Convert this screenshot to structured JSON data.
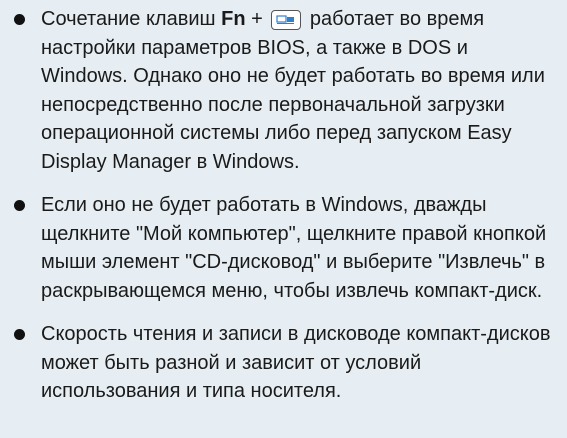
{
  "items": [
    {
      "parts": {
        "p1": "Сочетание клавиш ",
        "fn": "Fn",
        "plus": " + ",
        "key_icon": "display-toggle-key-icon",
        "p2": " работает во время настройки параметров BIOS, а также в DOS и Windows. Однако оно не будет работать во время или непосредственно после первоначальной загрузки операционной системы либо перед запуском Easy Display Manager в Windows."
      }
    },
    {
      "text": "Если оно не будет работать в Windows, дважды щелкните \"Мой компьютер\", щелкните правой кнопкой мыши элемент \"CD-дисковод\" и выберите \"Извлечь\" в раскрывающемся меню, чтобы извлечь компакт-диск."
    },
    {
      "text": "Скорость чтения и записи в дисководе компакт-дисков может быть разной и зависит от условий использования и типа носителя."
    }
  ],
  "colors": {
    "background": "#e6eef3",
    "text": "#1a1a1a",
    "bullet": "#111111",
    "key_accent": "#2f7fd0"
  }
}
